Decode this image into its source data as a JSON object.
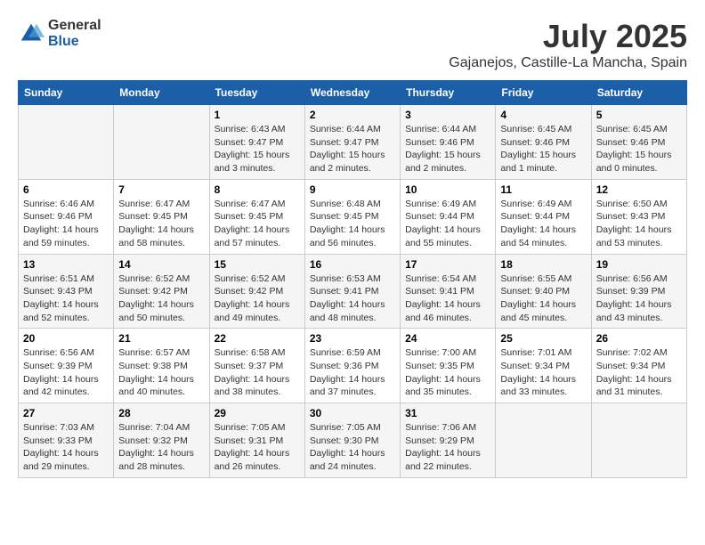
{
  "header": {
    "logo_general": "General",
    "logo_blue": "Blue",
    "title": "July 2025",
    "subtitle": "Gajanejos, Castille-La Mancha, Spain"
  },
  "calendar": {
    "days_of_week": [
      "Sunday",
      "Monday",
      "Tuesday",
      "Wednesday",
      "Thursday",
      "Friday",
      "Saturday"
    ],
    "weeks": [
      [
        {
          "day": "",
          "info": ""
        },
        {
          "day": "",
          "info": ""
        },
        {
          "day": "1",
          "info": "Sunrise: 6:43 AM\nSunset: 9:47 PM\nDaylight: 15 hours\nand 3 minutes."
        },
        {
          "day": "2",
          "info": "Sunrise: 6:44 AM\nSunset: 9:47 PM\nDaylight: 15 hours\nand 2 minutes."
        },
        {
          "day": "3",
          "info": "Sunrise: 6:44 AM\nSunset: 9:46 PM\nDaylight: 15 hours\nand 2 minutes."
        },
        {
          "day": "4",
          "info": "Sunrise: 6:45 AM\nSunset: 9:46 PM\nDaylight: 15 hours\nand 1 minute."
        },
        {
          "day": "5",
          "info": "Sunrise: 6:45 AM\nSunset: 9:46 PM\nDaylight: 15 hours\nand 0 minutes."
        }
      ],
      [
        {
          "day": "6",
          "info": "Sunrise: 6:46 AM\nSunset: 9:46 PM\nDaylight: 14 hours\nand 59 minutes."
        },
        {
          "day": "7",
          "info": "Sunrise: 6:47 AM\nSunset: 9:45 PM\nDaylight: 14 hours\nand 58 minutes."
        },
        {
          "day": "8",
          "info": "Sunrise: 6:47 AM\nSunset: 9:45 PM\nDaylight: 14 hours\nand 57 minutes."
        },
        {
          "day": "9",
          "info": "Sunrise: 6:48 AM\nSunset: 9:45 PM\nDaylight: 14 hours\nand 56 minutes."
        },
        {
          "day": "10",
          "info": "Sunrise: 6:49 AM\nSunset: 9:44 PM\nDaylight: 14 hours\nand 55 minutes."
        },
        {
          "day": "11",
          "info": "Sunrise: 6:49 AM\nSunset: 9:44 PM\nDaylight: 14 hours\nand 54 minutes."
        },
        {
          "day": "12",
          "info": "Sunrise: 6:50 AM\nSunset: 9:43 PM\nDaylight: 14 hours\nand 53 minutes."
        }
      ],
      [
        {
          "day": "13",
          "info": "Sunrise: 6:51 AM\nSunset: 9:43 PM\nDaylight: 14 hours\nand 52 minutes."
        },
        {
          "day": "14",
          "info": "Sunrise: 6:52 AM\nSunset: 9:42 PM\nDaylight: 14 hours\nand 50 minutes."
        },
        {
          "day": "15",
          "info": "Sunrise: 6:52 AM\nSunset: 9:42 PM\nDaylight: 14 hours\nand 49 minutes."
        },
        {
          "day": "16",
          "info": "Sunrise: 6:53 AM\nSunset: 9:41 PM\nDaylight: 14 hours\nand 48 minutes."
        },
        {
          "day": "17",
          "info": "Sunrise: 6:54 AM\nSunset: 9:41 PM\nDaylight: 14 hours\nand 46 minutes."
        },
        {
          "day": "18",
          "info": "Sunrise: 6:55 AM\nSunset: 9:40 PM\nDaylight: 14 hours\nand 45 minutes."
        },
        {
          "day": "19",
          "info": "Sunrise: 6:56 AM\nSunset: 9:39 PM\nDaylight: 14 hours\nand 43 minutes."
        }
      ],
      [
        {
          "day": "20",
          "info": "Sunrise: 6:56 AM\nSunset: 9:39 PM\nDaylight: 14 hours\nand 42 minutes."
        },
        {
          "day": "21",
          "info": "Sunrise: 6:57 AM\nSunset: 9:38 PM\nDaylight: 14 hours\nand 40 minutes."
        },
        {
          "day": "22",
          "info": "Sunrise: 6:58 AM\nSunset: 9:37 PM\nDaylight: 14 hours\nand 38 minutes."
        },
        {
          "day": "23",
          "info": "Sunrise: 6:59 AM\nSunset: 9:36 PM\nDaylight: 14 hours\nand 37 minutes."
        },
        {
          "day": "24",
          "info": "Sunrise: 7:00 AM\nSunset: 9:35 PM\nDaylight: 14 hours\nand 35 minutes."
        },
        {
          "day": "25",
          "info": "Sunrise: 7:01 AM\nSunset: 9:34 PM\nDaylight: 14 hours\nand 33 minutes."
        },
        {
          "day": "26",
          "info": "Sunrise: 7:02 AM\nSunset: 9:34 PM\nDaylight: 14 hours\nand 31 minutes."
        }
      ],
      [
        {
          "day": "27",
          "info": "Sunrise: 7:03 AM\nSunset: 9:33 PM\nDaylight: 14 hours\nand 29 minutes."
        },
        {
          "day": "28",
          "info": "Sunrise: 7:04 AM\nSunset: 9:32 PM\nDaylight: 14 hours\nand 28 minutes."
        },
        {
          "day": "29",
          "info": "Sunrise: 7:05 AM\nSunset: 9:31 PM\nDaylight: 14 hours\nand 26 minutes."
        },
        {
          "day": "30",
          "info": "Sunrise: 7:05 AM\nSunset: 9:30 PM\nDaylight: 14 hours\nand 24 minutes."
        },
        {
          "day": "31",
          "info": "Sunrise: 7:06 AM\nSunset: 9:29 PM\nDaylight: 14 hours\nand 22 minutes."
        },
        {
          "day": "",
          "info": ""
        },
        {
          "day": "",
          "info": ""
        }
      ]
    ]
  }
}
